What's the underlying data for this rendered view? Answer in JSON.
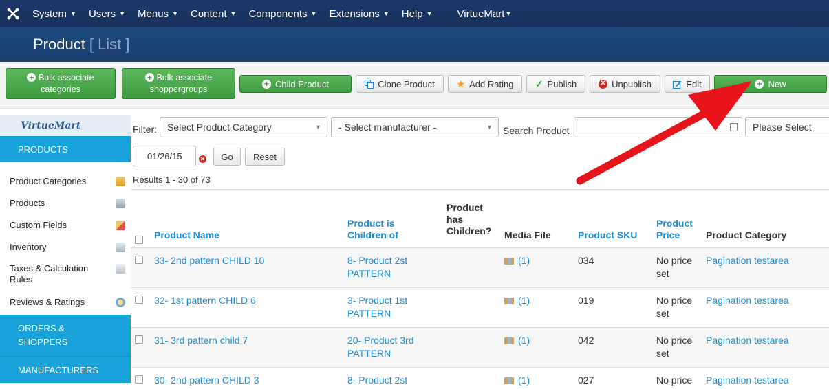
{
  "topbar": {
    "menus": [
      "System",
      "Users",
      "Menus",
      "Content",
      "Components",
      "Extensions",
      "Help"
    ],
    "vm": "VirtueMart"
  },
  "titlebar": {
    "title": "Product",
    "subtitle": "[ List ]"
  },
  "toolbar": {
    "bulk_cat_1": "Bulk associate",
    "bulk_cat_2": "categories",
    "bulk_sg_1": "Bulk associate",
    "bulk_sg_2": "shoppergroups",
    "child": "Child Product",
    "clone": "Clone Product",
    "rating": "Add Rating",
    "publish": "Publish",
    "unpublish": "Unpublish",
    "edit": "Edit",
    "new": "New"
  },
  "sidebar": {
    "logo": "VirtueMart",
    "section_products": "PRODUCTS",
    "items": [
      {
        "label": "Product Categories",
        "icon": "folder-icon"
      },
      {
        "label": "Products",
        "icon": "camera-icon"
      },
      {
        "label": "Custom Fields",
        "icon": "fields-icon"
      },
      {
        "label": "Inventory",
        "icon": "inventory-icon"
      },
      {
        "label": "Taxes & Calculation Rules",
        "icon": "calculator-icon"
      },
      {
        "label": "Reviews & Ratings",
        "icon": "speech-bubble-icon"
      }
    ],
    "section_orders": "ORDERS & SHOPPERS",
    "section_manufacturers": "MANUFACTURERS"
  },
  "filters": {
    "filter_label": "Filter:",
    "category": "Select Product Category",
    "manufacturer": "- Select manufacturer -",
    "search_label": "Search Product",
    "search_value": "",
    "please_select": "Please Select",
    "date": "01/26/15",
    "go": "Go",
    "reset": "Reset"
  },
  "results": "Results 1 - 30 of 73",
  "table": {
    "headers": {
      "name": "Product Name",
      "children_of_1": "Product is",
      "children_of_2": "Children of",
      "has_children_1": "Product",
      "has_children_2": "has",
      "has_children_3": "Children?",
      "media": "Media File",
      "sku": "Product SKU",
      "price_1": "Product",
      "price_2": "Price",
      "category": "Product Category"
    },
    "rows": [
      {
        "name": "33- 2nd pattern CHILD 10",
        "parent_1": "8- Product 2st",
        "parent_2": "PATTERN",
        "media": "(1)",
        "sku": "034",
        "price_1": "No price",
        "price_2": "set",
        "category": "Pagination testarea"
      },
      {
        "name": "32- 1st pattern CHILD 6",
        "parent_1": "3- Product 1st",
        "parent_2": "PATTERN",
        "media": "(1)",
        "sku": "019",
        "price_1": "No price",
        "price_2": "set",
        "category": "Pagination testarea"
      },
      {
        "name": "31- 3rd pattern child 7",
        "parent_1": "20- Product 3rd",
        "parent_2": "PATTERN",
        "media": "(1)",
        "sku": "042",
        "price_1": "No price",
        "price_2": "set",
        "category": "Pagination testarea"
      },
      {
        "name": "30- 2nd pattern CHILD 3",
        "parent_1": "8- Product 2st",
        "parent_2": "",
        "media": "(1)",
        "sku": "027",
        "price_1": "No price",
        "price_2": "",
        "category": "Pagination testarea"
      }
    ]
  },
  "colors": {
    "topbar": "#17325c",
    "accent": "#19a3da",
    "link": "#1a8cd8",
    "green": "#3e9a3e",
    "arrow": "#e8141b"
  }
}
